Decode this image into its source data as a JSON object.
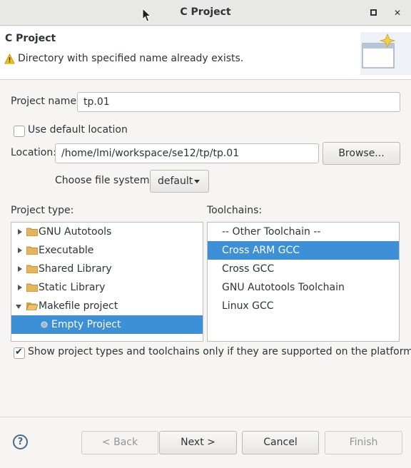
{
  "window": {
    "title": "C Project",
    "maximize_icon": "maximize-icon",
    "close_icon": "close-icon",
    "close_glyph": "✕"
  },
  "header": {
    "title": "C Project",
    "message": "Directory with specified name already exists.",
    "icon": "warning-icon"
  },
  "project_name": {
    "label": "Project name:",
    "value": "tp.01"
  },
  "default_location": {
    "label": "Use default location",
    "checked": false
  },
  "location": {
    "label": "Location:",
    "value": "/home/lmi/workspace/se12/tp/tp.01",
    "browse_label": "Browse..."
  },
  "file_system": {
    "label": "Choose file system:",
    "value": "default"
  },
  "project_type": {
    "label": "Project type:",
    "items": [
      {
        "label": "GNU Autotools",
        "expanded": false
      },
      {
        "label": "Executable",
        "expanded": false
      },
      {
        "label": "Shared Library",
        "expanded": false
      },
      {
        "label": "Static Library",
        "expanded": false
      },
      {
        "label": "Makefile project",
        "expanded": true
      },
      {
        "label": "Empty Project",
        "child": true,
        "selected": true
      }
    ]
  },
  "toolchains": {
    "label": "Toolchains:",
    "items": [
      {
        "label": "-- Other Toolchain --"
      },
      {
        "label": "Cross ARM GCC",
        "selected": true
      },
      {
        "label": "Cross GCC"
      },
      {
        "label": "GNU Autotools Toolchain"
      },
      {
        "label": "Linux GCC"
      }
    ]
  },
  "show_supported": {
    "label": "Show project types and toolchains only if they are supported on the platform",
    "checked": true
  },
  "footer": {
    "help_glyph": "?",
    "back_label": "< Back",
    "next_label": "Next >",
    "cancel_label": "Cancel",
    "finish_label": "Finish"
  },
  "colors": {
    "selection": "#3d8fd6",
    "folder": "#e8b45a"
  }
}
